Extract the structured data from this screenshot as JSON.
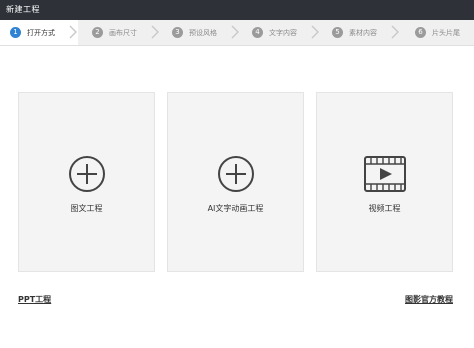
{
  "window": {
    "title": "新建工程"
  },
  "steps": [
    {
      "number": "1",
      "label": "打开方式"
    },
    {
      "number": "2",
      "label": "画布尺寸"
    },
    {
      "number": "3",
      "label": "预设风格"
    },
    {
      "number": "4",
      "label": "文字内容"
    },
    {
      "number": "5",
      "label": "素材内容"
    },
    {
      "number": "6",
      "label": "片头片尾"
    }
  ],
  "options": [
    {
      "label": "图文工程",
      "icon": "plus-circle-icon"
    },
    {
      "label": "AI文字动画工程",
      "icon": "plus-circle-icon"
    },
    {
      "label": "视频工程",
      "icon": "video-play-icon"
    }
  ],
  "links": {
    "ppt": "PPT工程",
    "tutorial": "图影官方教程"
  },
  "colors": {
    "titlebar": "#2e3238",
    "accent": "#2f82d4",
    "card_bg": "#f4f4f4"
  }
}
